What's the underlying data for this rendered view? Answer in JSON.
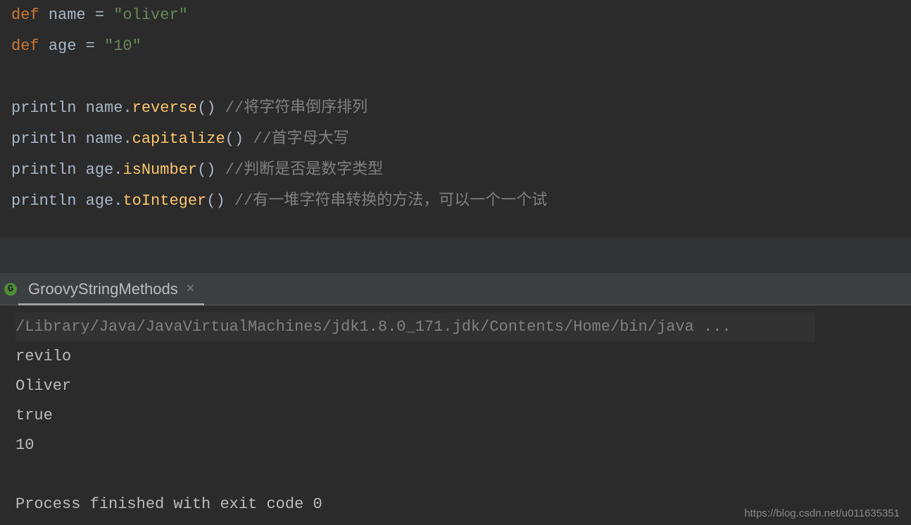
{
  "code": {
    "lines": [
      {
        "tokens": [
          {
            "t": "kw",
            "v": "def "
          },
          {
            "t": "ident",
            "v": "name"
          },
          {
            "t": "eq",
            "v": " = "
          },
          {
            "t": "str",
            "v": "\"oliver\""
          }
        ]
      },
      {
        "tokens": [
          {
            "t": "kw",
            "v": "def "
          },
          {
            "t": "ident",
            "v": "age"
          },
          {
            "t": "eq",
            "v": " = "
          },
          {
            "t": "str",
            "v": "\"10\""
          }
        ]
      },
      {
        "tokens": []
      },
      {
        "tokens": [
          {
            "t": "ident",
            "v": "println "
          },
          {
            "t": "ident",
            "v": "name"
          },
          {
            "t": "punct",
            "v": "."
          },
          {
            "t": "method",
            "v": "reverse"
          },
          {
            "t": "punct",
            "v": "()"
          },
          {
            "t": "comment",
            "v": " //将字符串倒序排列"
          }
        ]
      },
      {
        "tokens": [
          {
            "t": "ident",
            "v": "println "
          },
          {
            "t": "ident",
            "v": "name"
          },
          {
            "t": "punct",
            "v": "."
          },
          {
            "t": "method",
            "v": "capitalize"
          },
          {
            "t": "punct",
            "v": "()"
          },
          {
            "t": "comment",
            "v": " //首字母大写"
          }
        ]
      },
      {
        "tokens": [
          {
            "t": "ident",
            "v": "println "
          },
          {
            "t": "ident",
            "v": "age"
          },
          {
            "t": "punct",
            "v": "."
          },
          {
            "t": "method",
            "v": "isNumber"
          },
          {
            "t": "punct",
            "v": "()"
          },
          {
            "t": "comment",
            "v": " //判断是否是数字类型"
          }
        ]
      },
      {
        "tokens": [
          {
            "t": "ident",
            "v": "println "
          },
          {
            "t": "ident",
            "v": "age"
          },
          {
            "t": "punct",
            "v": "."
          },
          {
            "t": "method",
            "v": "toInteger"
          },
          {
            "t": "punct",
            "v": "()"
          },
          {
            "t": "comment",
            "v": " //有一堆字符串转换的方法，可以一个一个试"
          }
        ]
      }
    ]
  },
  "run_tab": {
    "icon_letter": "G",
    "label": "GroovyStringMethods",
    "close": "×"
  },
  "console": {
    "cmd": "/Library/Java/JavaVirtualMachines/jdk1.8.0_171.jdk/Contents/Home/bin/java ...",
    "out": [
      "revilo",
      "Oliver",
      "true",
      "10",
      "",
      "Process finished with exit code 0"
    ]
  },
  "watermark": "https://blog.csdn.net/u011635351"
}
